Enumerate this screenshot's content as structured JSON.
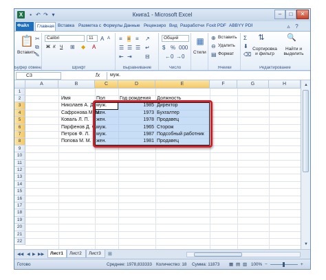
{
  "window": {
    "title": "Книга1 - Microsoft Excel",
    "controls": {
      "minimize": "–",
      "maximize": "□",
      "close": "✕"
    },
    "accent": "#1f6fbf"
  },
  "tabs": [
    "Файл",
    "Главная",
    "Вставка",
    "Разметка с",
    "Формулы",
    "Данные",
    "Рецензиро",
    "Вид",
    "Разработчи",
    "Foxit PDF",
    "ABBYY PDF"
  ],
  "ribbon": {
    "clipboard": {
      "paste": "Вставить",
      "label": "Буфер обмена"
    },
    "font": {
      "name": "Calibri",
      "size": "11",
      "bold": "Ж",
      "italic": "К",
      "underline": "Ч",
      "label": "Шрифт"
    },
    "alignment": {
      "label": "Выравнивание"
    },
    "number": {
      "format": "Общий",
      "label": "Число"
    },
    "styles": {
      "button": "Стили"
    },
    "cells": {
      "insert": "Вставить",
      "delete": "Удалить",
      "format": "Формат",
      "label": "Ячейки"
    },
    "editing": {
      "sort": "Сортировка и фильтр",
      "find": "Найти и выделить",
      "label": "Редактирование"
    }
  },
  "formula_bar": {
    "name_box": "C3",
    "fx": "fx",
    "value": "муж."
  },
  "columns": [
    "A",
    "B",
    "C",
    "D",
    "E",
    "F",
    "G",
    "H"
  ],
  "rows": [
    "1",
    "2",
    "3",
    "4",
    "5",
    "6",
    "7",
    "8",
    "9",
    "10",
    "11",
    "12",
    "13",
    "14",
    "15",
    "16",
    "17",
    "18",
    "19",
    "20",
    "21",
    "22"
  ],
  "table": {
    "headers": {
      "name": "Имя",
      "gender": "Пол",
      "year": "Год рождения",
      "position": "Должность"
    },
    "records": [
      {
        "name": "Николаев А. Д.",
        "gender": "муж.",
        "year": "1985",
        "position": "Директор"
      },
      {
        "name": "Сафронова М. М.",
        "gender": "жен.",
        "year": "1973",
        "position": "Бухгалтер"
      },
      {
        "name": "Коваль Л. П.",
        "gender": "жен.",
        "year": "1978",
        "position": "Продавец"
      },
      {
        "name": "Парфенов Д. Ф.",
        "gender": "муж.",
        "year": "1965",
        "position": "Сторож"
      },
      {
        "name": "Петров Ф. Л.",
        "gender": "муж.",
        "year": "1987",
        "position": "Подсобный работник"
      },
      {
        "name": "Попова М. М.",
        "gender": "жен.",
        "year": "1981",
        "position": "Продавец"
      }
    ]
  },
  "sheets": [
    "Лист1",
    "Лист2",
    "Лист3"
  ],
  "status": {
    "ready": "Готово",
    "average": "Среднее: 1978,833333",
    "count": "Количество: 18",
    "sum": "Сумма: 11873",
    "zoom": "100%"
  },
  "colors": {
    "selection": "#9bc3f0",
    "highlight_frame": "#d0202a"
  }
}
